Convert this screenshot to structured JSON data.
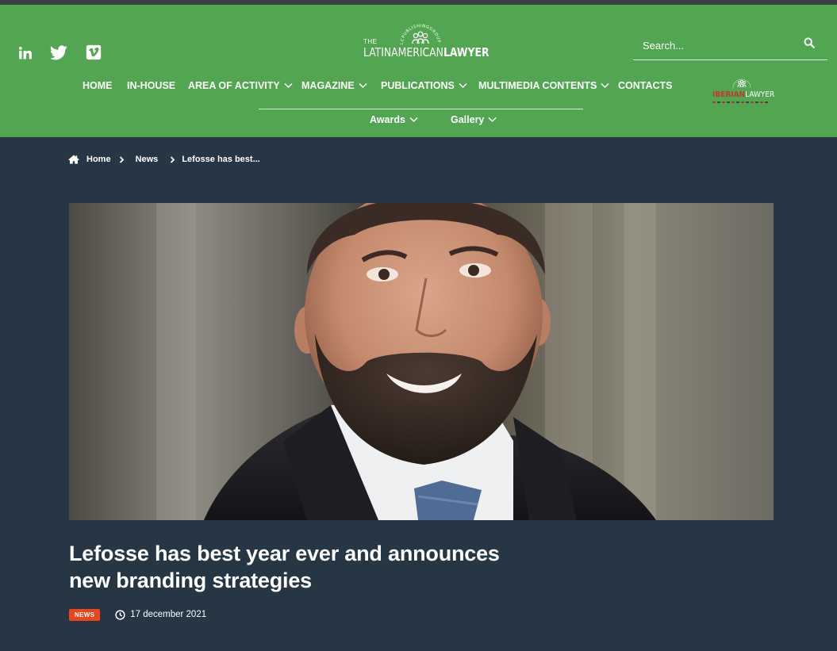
{
  "colors": {
    "header_bg": "#53a651",
    "page_bg": "#263645",
    "badge_bg": "#e8461c",
    "iberian_red": "#c0392b"
  },
  "social": [
    {
      "name": "linkedin-icon"
    },
    {
      "name": "twitter-icon"
    },
    {
      "name": "vimeo-icon"
    }
  ],
  "logo": {
    "the": "THE",
    "brand_light": "LATINAMERICAN",
    "brand_bold": "LAWYER",
    "publisher_ring": "LCPUBLISHINGGROUP"
  },
  "search": {
    "placeholder": "Search...",
    "icon": "search-icon"
  },
  "nav": {
    "items": [
      {
        "label": "HOME"
      },
      {
        "label": "IN-HOUSE"
      },
      {
        "label": "AREA OF ACTIVITY",
        "has_dropdown": true
      },
      {
        "label": "MAGAZINE",
        "has_dropdown": true
      },
      {
        "label": "PUBLICATIONS",
        "has_dropdown": true
      },
      {
        "label": "MULTIMEDIA CONTENTS",
        "has_dropdown": true
      },
      {
        "label": "CONTACTS"
      }
    ],
    "secondary": [
      {
        "label": "Awards",
        "has_dropdown": true
      },
      {
        "label": "Gallery",
        "has_dropdown": true
      }
    ]
  },
  "partner_logo": {
    "red": "IBERIAN",
    "white": "LAWYER"
  },
  "breadcrumb": {
    "home": "Home",
    "section": "News",
    "current": "Lefosse has best..."
  },
  "article": {
    "title": "Lefosse has best year ever and announces new branding strategies",
    "category": "NEWS",
    "date": "17 december 2021"
  }
}
